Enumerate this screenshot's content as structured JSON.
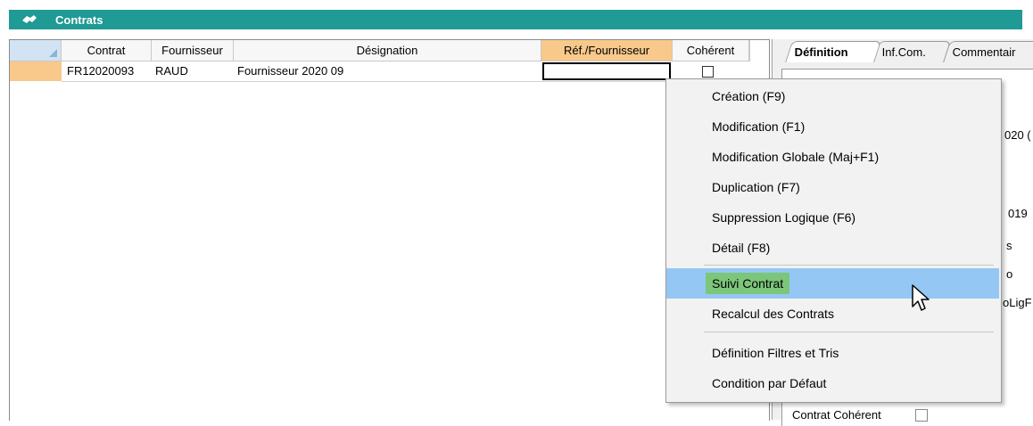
{
  "window": {
    "title": "Contrats",
    "logo_icon": "handshake-icon"
  },
  "grid": {
    "columns": [
      "Contrat",
      "Fournisseur",
      "Désignation",
      "Réf./Fournisseur",
      "Cohérent"
    ],
    "rows": [
      {
        "contrat": "FR12020093",
        "fournisseur": "RAUD",
        "designation": "Fournisseur 2020 09",
        "ref_fournisseur": "",
        "coherent": false
      }
    ]
  },
  "right_panel": {
    "tabs": [
      "Définition",
      "Inf.Com.",
      "Commentair"
    ],
    "visible_fragments": [
      "020 (",
      "019",
      "s",
      "o",
      "oLigF"
    ],
    "bottom_label": "Contrat Cohérent"
  },
  "context_menu": {
    "items": [
      "Création (F9)",
      "Modification (F1)",
      "Modification Globale (Maj+F1)",
      "Duplication (F7)",
      "Suppression Logique (F6)",
      "Détail (F8)",
      "Suivi Contrat",
      "Recalcul des Contrats",
      "Définition Filtres et Tris",
      "Condition par Défaut"
    ],
    "highlighted": "Suivi Contrat"
  },
  "colors": {
    "titlebar": "#1f9a94",
    "selected_header": "#f8c98a",
    "menu_highlight": "#94c7f4",
    "label_highlight": "#7cc67a"
  }
}
